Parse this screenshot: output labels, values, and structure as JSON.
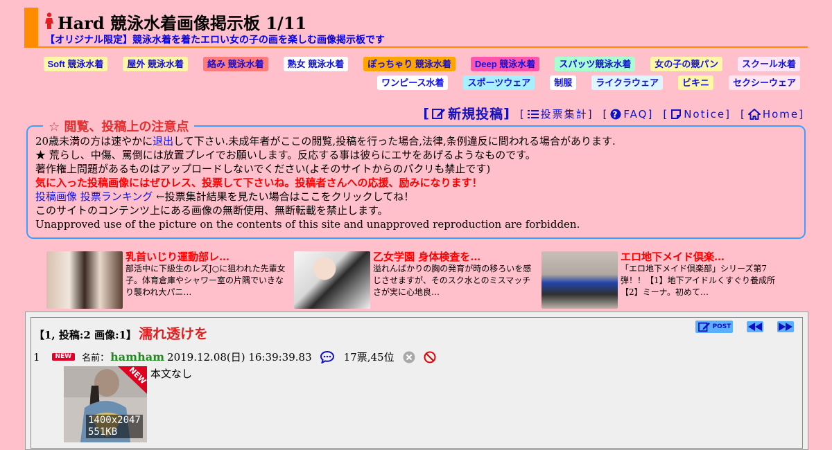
{
  "header": {
    "title": "Hard 競泳水着画像掲示板 1/11",
    "subtitle": "【オリジナル限定】競泳水着を着たエロい女の子の画を楽しむ画像掲示板です"
  },
  "categories_row1": [
    {
      "label": "Soft 競泳水着",
      "bg": "#fff7a8"
    },
    {
      "label": "屋外 競泳水着",
      "bg": "#fff7a8"
    },
    {
      "label": "絡み 競泳水着",
      "bg": "#ff7b7b"
    },
    {
      "label": "熟女 競泳水着",
      "bg": "#ffffff"
    },
    {
      "label": "ぽっちゃり 競泳水着",
      "bg": "#ffa500"
    },
    {
      "label": "Deep 競泳水着",
      "bg": "#ff55aa"
    },
    {
      "label": "スパッツ競泳水着",
      "bg": "#a8ffd0"
    },
    {
      "label": "女の子の競パン",
      "bg": "#fff7a8"
    },
    {
      "label": "スクール水着",
      "bg": "#ffe6f7"
    }
  ],
  "categories_row2": [
    {
      "label": "ワンピース水着",
      "bg": "#ffffff"
    },
    {
      "label": "スポーツウェア",
      "bg": "#a8f0ff"
    },
    {
      "label": "制服",
      "bg": "#ffffff"
    },
    {
      "label": "ライクラウェア",
      "bg": "#ddf6ff"
    },
    {
      "label": "ビキニ",
      "bg": "#fff7a8"
    },
    {
      "label": "セクシーウェア",
      "bg": "#ffe6f0"
    }
  ],
  "nav": {
    "new_post": "新規投稿",
    "vote_tally": "投票集計",
    "faq": "FAQ",
    "notice": "Notice",
    "home": "Home",
    "open_bracket": "[",
    "close_bracket": "]"
  },
  "notice": {
    "legend": "☆ 閲覧、投稿上の注意点",
    "line1_a": "20歳未満の方は速やかに",
    "line1_link": "退出",
    "line1_b": "して下さい.未成年者がここの閲覧,投稿を行った場合,法律,条例違反に問われる場合があります.",
    "line2": "★ 荒らし、中傷、罵倒には放置プレイでお願いします。反応する事は彼らにエサをあげるようなものです。",
    "line3": "著作権上問題があるものはアップロードしないでください(よそのサイトからのパクリも禁止です)",
    "line4": "気に入った投稿画像にはぜひレス、投票して下さいね。投稿者さんへの応援、励みになります！",
    "line5_link": "投稿画像 投票ランキング",
    "line5_b": " ←投票集計結果を見たい場合はここをクリックしてね！",
    "line6": "このサイトのコンテンツ上にある画像の無断使用、無断転載を禁止します。",
    "line7": "Unapproved use of the picture on the contents of this site and unapproved reproduction are forbidden."
  },
  "ads": [
    {
      "title": "乳首いじり運動部レ…",
      "desc": "部活中に下級生のレズJ○に狙われた先輩女子。体育倉庫やシャワー室の片隅でいきなり襲われ大パニ…"
    },
    {
      "title": "乙女学園 身体検査を…",
      "desc": "溢れんばかりの胸の発育が時の移ろいを感じさせますが、そのスク水とのミスマッチさが実に心地良…"
    },
    {
      "title": "エロ地下メイド倶楽…",
      "desc": "「エロ地下メイド倶楽部」シリーズ第7弾！！【1】地下アイドルくすぐり養成所【2】ミーナ。初めて…"
    }
  ],
  "thread": {
    "meta": "【1, 投稿:2 画像:1】",
    "title": "濡れ透けを",
    "post_label": "POST",
    "post": {
      "number": "1",
      "new_badge": "NEW",
      "name_label": "名前：",
      "name": "hamham",
      "date": "2019.12.08(日) 16:39:39.83",
      "votes": "17票,45位",
      "img_size": "1400x2047",
      "img_kb": "551KB",
      "corner_badge": "NEW",
      "body": "本文なし"
    }
  }
}
